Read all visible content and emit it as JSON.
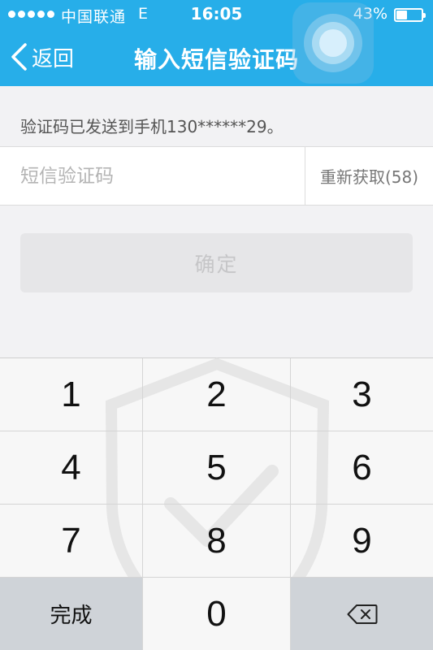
{
  "status_bar": {
    "carrier": "中国联通",
    "network": "E",
    "time": "16:05",
    "battery": "43%",
    "battery_level": 0.43
  },
  "nav": {
    "back_label": "返回",
    "title": "输入短信验证码"
  },
  "sent_info": "验证码已发送到手机130******29。",
  "code_input": {
    "placeholder": "短信验证码",
    "value": ""
  },
  "resend_label": "重新获取(58)",
  "confirm_label": "确定",
  "keypad": {
    "keys": [
      "1",
      "2",
      "3",
      "4",
      "5",
      "6",
      "7",
      "8",
      "9"
    ],
    "done_label": "完成",
    "zero": "0",
    "delete_icon": "backspace-icon"
  },
  "colors": {
    "header": "#27aee9",
    "background": "#f2f2f4",
    "keypad": "#f7f7f7",
    "key_dark": "#cfd3d8"
  }
}
